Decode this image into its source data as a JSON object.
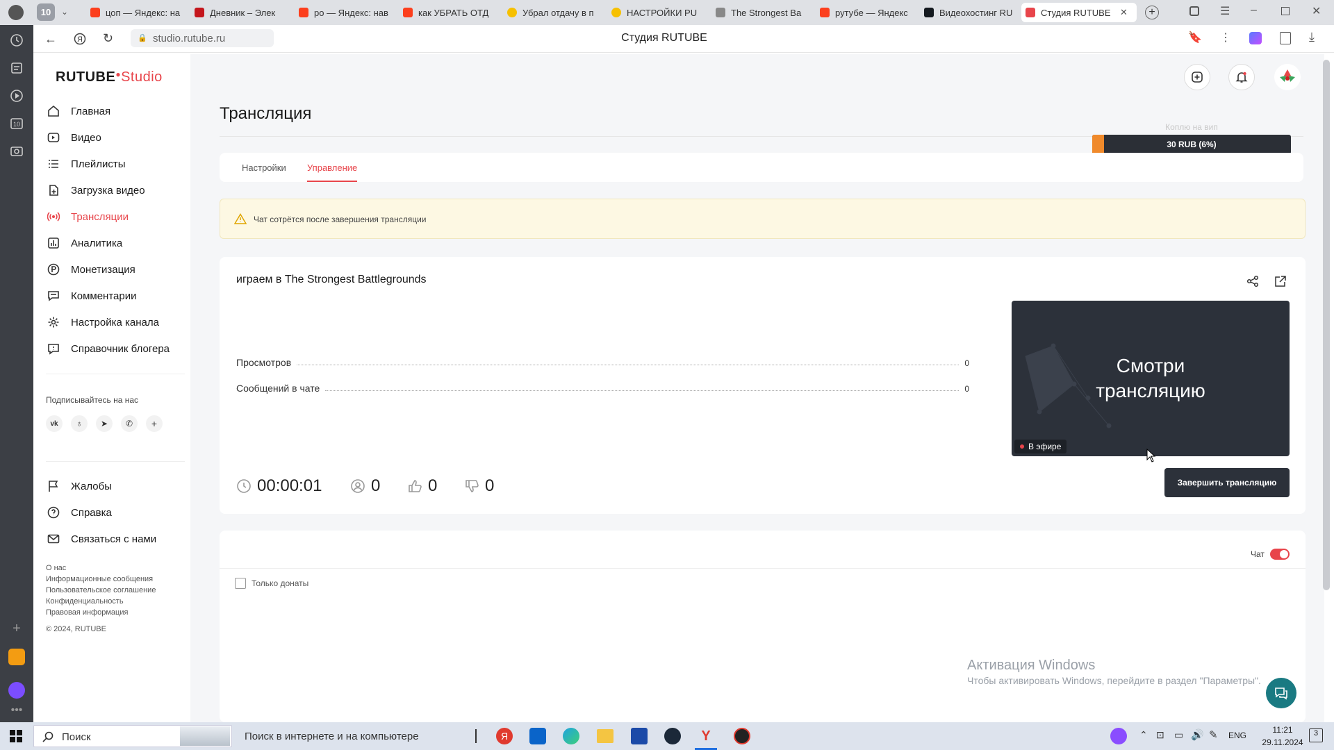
{
  "browser": {
    "tab_count": "10",
    "tabs": [
      {
        "title": "цоп — Яндекс: на",
        "color": "#fc3f1d"
      },
      {
        "title": "Дневник – Элек",
        "color": "#c4161c"
      },
      {
        "title": "ро — Яндекс: нав",
        "color": "#fc3f1d"
      },
      {
        "title": "как УБРАТЬ ОТД",
        "color": "#fc3f1d"
      },
      {
        "title": "Убрал отдачу в п",
        "color": "#f6c000"
      },
      {
        "title": "НАСТРОЙКИ PU",
        "color": "#f6c000"
      },
      {
        "title": "The Strongest Ba",
        "color": "#888888"
      },
      {
        "title": "рутубе — Яндекс",
        "color": "#fc3f1d"
      },
      {
        "title": "Видеохостинг RU",
        "color": "#14191f"
      },
      {
        "title": "Студия RUTUBE",
        "color": "#e8454b"
      }
    ],
    "url": "studio.rutube.ru",
    "page_title": "Студия RUTUBE"
  },
  "app": {
    "logo_rutube": "RUTUBE",
    "logo_studio": "Studio",
    "nav": [
      {
        "label": "Главная",
        "icon": "home-icon"
      },
      {
        "label": "Видео",
        "icon": "video-icon"
      },
      {
        "label": "Плейлисты",
        "icon": "playlist-icon"
      },
      {
        "label": "Загрузка видео",
        "icon": "upload-icon"
      },
      {
        "label": "Трансляции",
        "icon": "broadcast-icon",
        "active": true
      },
      {
        "label": "Аналитика",
        "icon": "analytics-icon"
      },
      {
        "label": "Монетизация",
        "icon": "monetization-icon"
      },
      {
        "label": "Комментарии",
        "icon": "comments-icon"
      },
      {
        "label": "Настройка канала",
        "icon": "settings-icon"
      },
      {
        "label": "Справочник блогера",
        "icon": "info-icon"
      }
    ],
    "subscribe_title": "Подписывайтесь на нас",
    "social": [
      "vk-icon",
      "ok-icon",
      "telegram-icon",
      "viber-icon",
      "plus-icon"
    ],
    "nav2": [
      {
        "label": "Жалобы",
        "icon": "flag-icon"
      },
      {
        "label": "Справка",
        "icon": "help-icon"
      },
      {
        "label": "Связаться с нами",
        "icon": "mail-icon"
      }
    ],
    "footer_links": [
      "О нас",
      "Информационные сообщения",
      "Пользовательское соглашение",
      "Конфиденциальность",
      "Правовая информация"
    ],
    "copyright": "© 2024, RUTUBE"
  },
  "page": {
    "title": "Трансляция",
    "tabs": [
      "Настройки",
      "Управление"
    ],
    "active_tab": "Управление",
    "warning": "Чат сотрётся после завершения трансляции",
    "stream": {
      "title": "играем в The Strongest Battlegrounds",
      "stats": [
        {
          "label": "Просмотров",
          "value": "0"
        },
        {
          "label": "Сообщений в чате",
          "value": "0"
        }
      ],
      "timer": "00:00:01",
      "viewers": "0",
      "likes": "0",
      "dislikes": "0",
      "preview_text_1": "Смотри",
      "preview_text_2": "трансляцию",
      "live_badge": "В эфире",
      "end_button": "Завершить трансляцию"
    },
    "donation": {
      "label": "Коплю на вип",
      "amount": "30 RUB (6%)",
      "progress": 0.06,
      "min": "0",
      "max": "500"
    },
    "chat": {
      "toggle_label": "Чат",
      "enabled": true,
      "only_donations_label": "Только донаты"
    }
  },
  "watermark": {
    "line1": "Активация Windows",
    "line2": "Чтобы активировать Windows, перейдите в раздел \"Параметры\"."
  },
  "taskbar": {
    "search_label": "Поиск",
    "search_hint": "Поиск в интернете и на компьютере",
    "lang": "ENG",
    "time": "11:21",
    "date": "29.11.2024"
  },
  "colors": {
    "accent": "#e8454b",
    "warning_bg": "#fdf8e3",
    "dark": "#2c313a"
  }
}
